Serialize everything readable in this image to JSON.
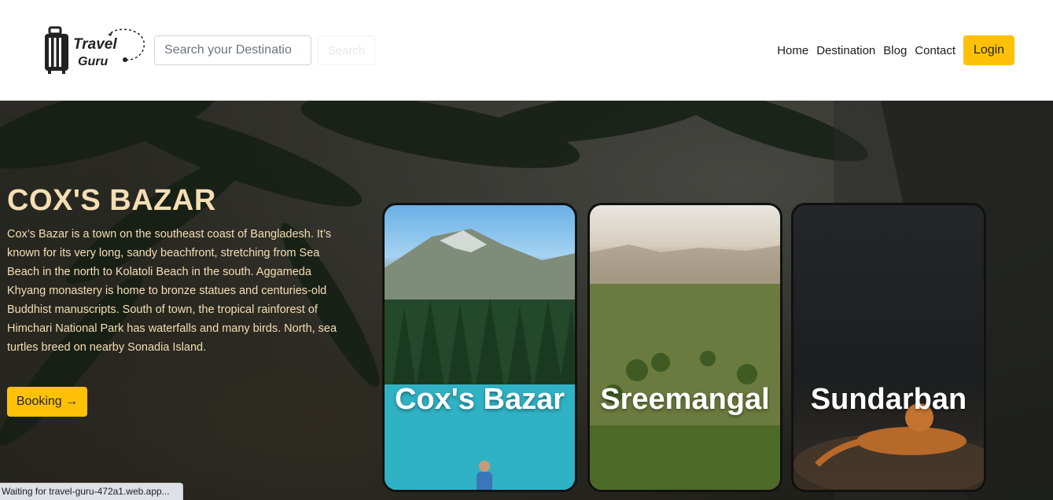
{
  "brand": {
    "name_line1": "Travel",
    "name_line2": "Guru"
  },
  "search": {
    "placeholder": "Search your Destinatio",
    "button_label": "Search"
  },
  "nav": {
    "items": [
      "Home",
      "Destination",
      "Blog",
      "Contact"
    ],
    "login_label": "Login"
  },
  "hero": {
    "title": "COX'S BAZAR",
    "description": "Cox’s Bazar is a town on the southeast coast of Bangladesh. It’s known for its very long, sandy beachfront, stretching from Sea Beach in the north to Kolatoli Beach in the south. Aggameda Khyang monastery is home to bronze statues and centuries-old Buddhist manuscripts. South of town, the tropical rainforest of Himchari National Park has waterfalls and many birds. North, sea turtles breed on nearby Sonadia Island.",
    "booking_label": "Booking →"
  },
  "cards": [
    {
      "label": "Cox's Bazar"
    },
    {
      "label": "Sreemangal"
    },
    {
      "label": "Sundarban"
    }
  ],
  "status_bar": {
    "text": "Waiting for travel-guru-472a1.web.app..."
  },
  "colors": {
    "accent": "#ffc107",
    "hero_text": "#f5deb3"
  },
  "icons": [
    "suitcase-icon"
  ]
}
